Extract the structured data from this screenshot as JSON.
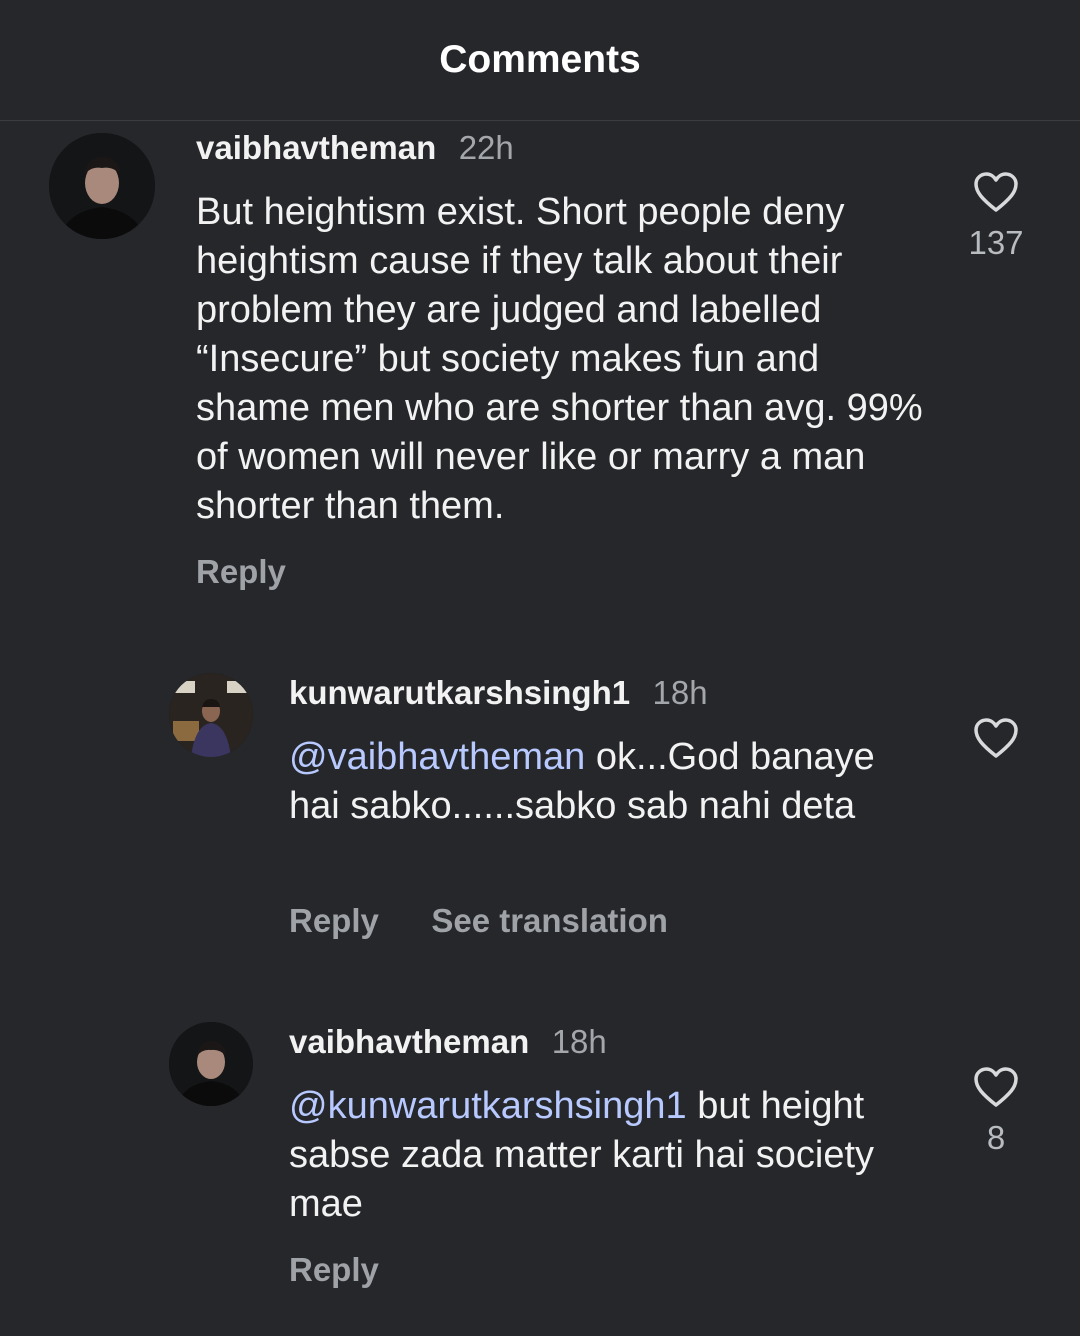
{
  "header": {
    "title": "Comments"
  },
  "comments": [
    {
      "username": "vaibhavtheman",
      "time": "22h",
      "mention": "",
      "text": "But heightism exist. Short people deny heightism cause if they talk about their problem they are judged and labelled “Insecure” but society makes fun and shame men who are shorter than avg. 99% of women will never like or marry a man shorter than them.",
      "like_count": "137",
      "reply_label": "Reply",
      "avatar_icon": "profile-photo"
    },
    {
      "username": "kunwarutkarshsingh1",
      "time": "18h",
      "mention": "@vaibhavtheman",
      "text": " ok...God banaye hai sabko......sabko sab nahi deta",
      "like_count": "",
      "reply_label": "Reply",
      "translate_label": "See translation",
      "avatar_icon": "profile-photo"
    },
    {
      "username": "vaibhavtheman",
      "time": "18h",
      "mention": "@kunwarutkarshsingh1",
      "text": " but height sabse zada matter karti hai society mae",
      "like_count": "8",
      "reply_label": "Reply",
      "avatar_icon": "profile-photo"
    }
  ],
  "icons": {
    "like": "heart-outline-icon"
  },
  "colors": {
    "background": "#25272b",
    "mention": "#b7c9ff",
    "muted": "#9fa2a7"
  }
}
